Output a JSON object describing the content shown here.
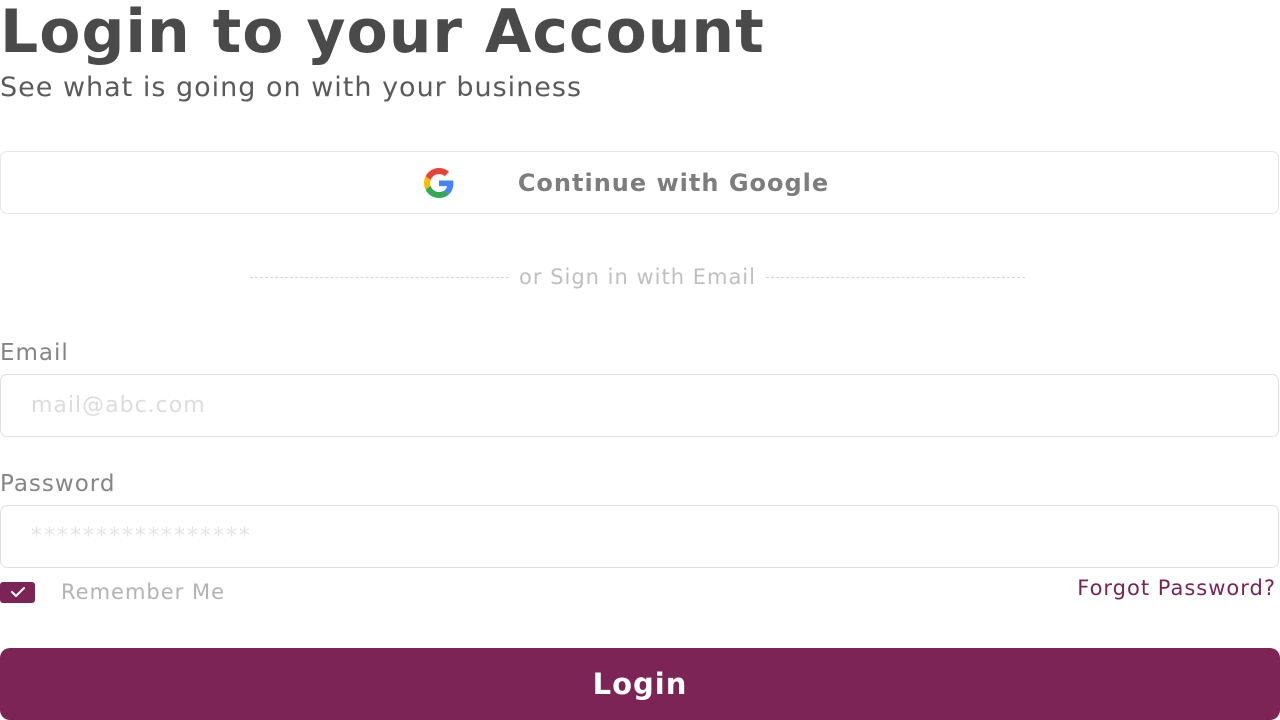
{
  "header": {
    "title": "Login to your Account",
    "subtitle": "See what is going on with your business"
  },
  "google_button": {
    "icon": "google-logo-icon",
    "label": "Continue with Google"
  },
  "divider": {
    "text": "or Sign in with Email"
  },
  "form": {
    "email": {
      "label": "Email",
      "placeholder": "mail@abc.com",
      "value": ""
    },
    "password": {
      "label": "Password",
      "placeholder": "*****************",
      "value": ""
    },
    "remember_me": {
      "label": "Remember Me",
      "checked": true,
      "icon": "check-icon"
    },
    "forgot_password": "Forgot Password?",
    "login_label": "Login"
  },
  "colors": {
    "accent": "#7b2455",
    "title": "#4a4a4a",
    "muted": "#b3b3b3",
    "border": "#e0e0e0"
  }
}
